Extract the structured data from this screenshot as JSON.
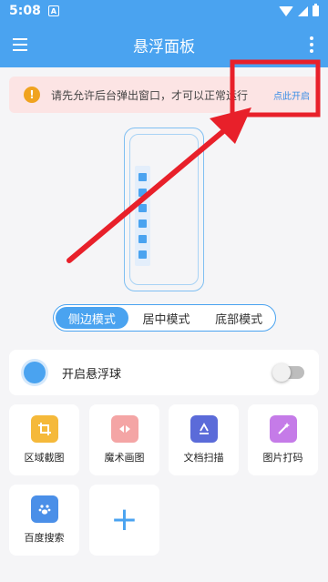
{
  "status": {
    "time": "5:08",
    "notif": "A"
  },
  "app": {
    "title": "悬浮面板"
  },
  "notice": {
    "text": "请先允许后台弹出窗口，才可以正常运行",
    "link": "点此开启"
  },
  "modes": [
    {
      "label": "侧边模式",
      "active": true
    },
    {
      "label": "居中模式",
      "active": false
    },
    {
      "label": "底部模式",
      "active": false
    }
  ],
  "toggle": {
    "label": "开启悬浮球",
    "enabled": false
  },
  "tools": [
    {
      "label": "区域截图",
      "icon": "crop-icon",
      "color": "#f5b93a"
    },
    {
      "label": "魔术画图",
      "icon": "magic-paint-icon",
      "color": "#f4a5a5"
    },
    {
      "label": "文档扫描",
      "icon": "scan-doc-icon",
      "color": "#5b6bd9"
    },
    {
      "label": "图片打码",
      "icon": "magic-wand-icon",
      "color": "#c57be8"
    },
    {
      "label": "百度搜索",
      "icon": "baidu-paw-icon",
      "color": "#4a8fe8"
    }
  ],
  "add_tool": {
    "label": "+"
  },
  "colors": {
    "primary": "#4aa3f0",
    "annotation": "#e8202a",
    "notice_bg": "#fce4e4"
  }
}
